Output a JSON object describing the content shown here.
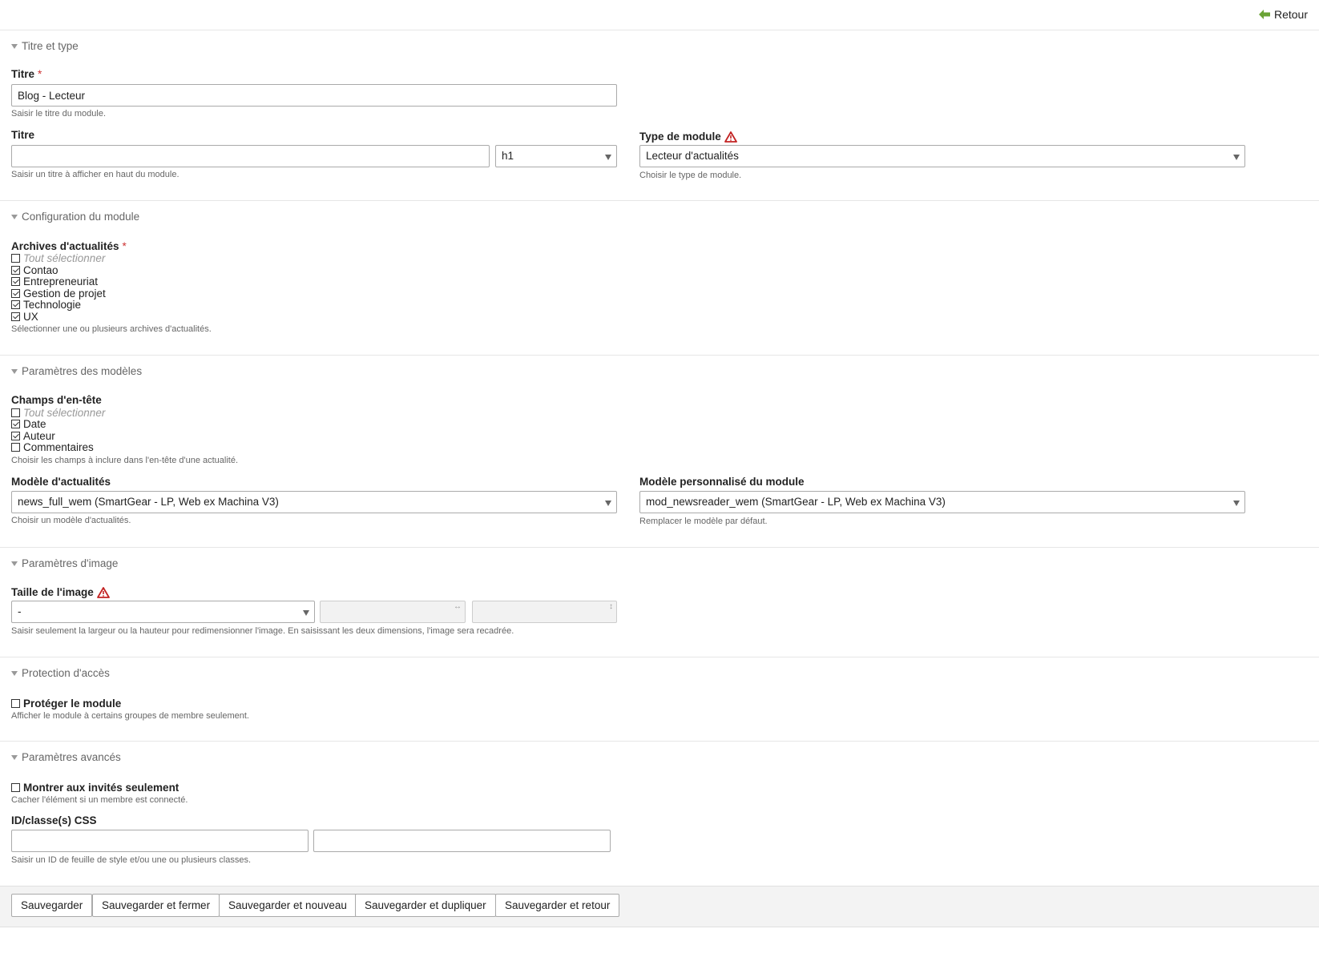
{
  "header": {
    "back_label": "Retour"
  },
  "sections": {
    "title_type": {
      "legend": "Titre et type",
      "title_label": "Titre",
      "title_value": "Blog - Lecteur",
      "title_help": "Saisir le titre du module.",
      "headline_label": "Titre",
      "headline_value": "",
      "headline_level": "h1",
      "headline_help": "Saisir un titre à afficher en haut du module.",
      "type_label": "Type de module",
      "type_value": "Lecteur d'actualités",
      "type_help": "Choisir le type de module."
    },
    "config": {
      "legend": "Configuration du module",
      "archives_label": "Archives d'actualités",
      "select_all": "Tout sélectionner",
      "archives": [
        {
          "label": "Contao",
          "checked": true
        },
        {
          "label": "Entrepreneuriat",
          "checked": true
        },
        {
          "label": "Gestion de projet",
          "checked": true
        },
        {
          "label": "Technologie",
          "checked": true
        },
        {
          "label": "UX",
          "checked": true
        }
      ],
      "archives_help": "Sélectionner une ou plusieurs archives d'actualités."
    },
    "templates": {
      "legend": "Paramètres des modèles",
      "header_fields_label": "Champs d'en-tête",
      "select_all": "Tout sélectionner",
      "header_fields": [
        {
          "label": "Date",
          "checked": true
        },
        {
          "label": "Auteur",
          "checked": true
        },
        {
          "label": "Commentaires",
          "checked": false
        }
      ],
      "header_fields_help": "Choisir les champs à inclure dans l'en-tête d'une actualité.",
      "news_template_label": "Modèle d'actualités",
      "news_template_value": "news_full_wem (SmartGear - LP, Web ex Machina V3)",
      "news_template_help": "Choisir un modèle d'actualités.",
      "custom_template_label": "Modèle personnalisé du module",
      "custom_template_value": "mod_newsreader_wem (SmartGear - LP, Web ex Machina V3)",
      "custom_template_help": "Remplacer le modèle par défaut."
    },
    "image": {
      "legend": "Paramètres d'image",
      "size_label": "Taille de l'image",
      "size_value": "-",
      "width_glyph": "↔",
      "height_glyph": "↕",
      "size_help": "Saisir seulement la largeur ou la hauteur pour redimensionner l'image. En saisissant les deux dimensions, l'image sera recadrée."
    },
    "protection": {
      "legend": "Protection d'accès",
      "protect_label": "Protéger le module",
      "protect_checked": false,
      "protect_help": "Afficher le module à certains groupes de membre seulement."
    },
    "advanced": {
      "legend": "Paramètres avancés",
      "guests_label": "Montrer aux invités seulement",
      "guests_checked": false,
      "guests_help": "Cacher l'élément si un membre est connecté.",
      "css_label": "ID/classe(s) CSS",
      "css_id_value": "",
      "css_class_value": "",
      "css_help": "Saisir un ID de feuille de style et/ou une ou plusieurs classes."
    }
  },
  "footer": {
    "save": "Sauvegarder",
    "save_close": "Sauvegarder et fermer",
    "save_new": "Sauvegarder et nouveau",
    "save_duplicate": "Sauvegarder et dupliquer",
    "save_back": "Sauvegarder et retour"
  },
  "colors": {
    "required": "#cc3333",
    "back_arrow": "#6aa335",
    "warning": "#c22222"
  }
}
